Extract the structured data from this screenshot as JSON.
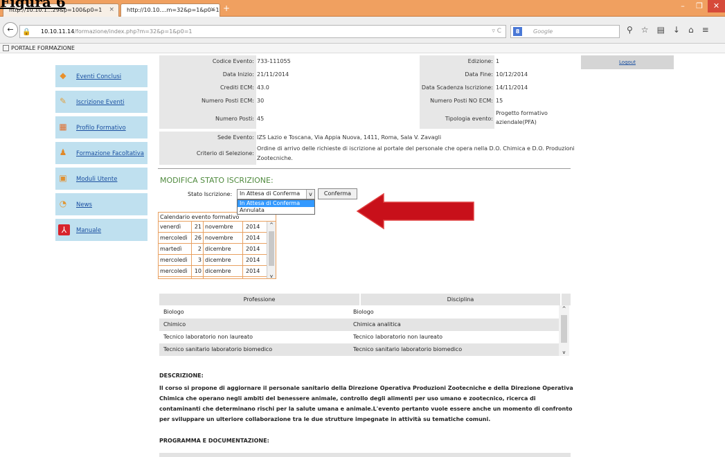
{
  "figure_label": "Figura 6",
  "browser": {
    "tabs": [
      {
        "title": "http://10.10.1...29&p=100&p0=1"
      },
      {
        "title": "http://10.10....m=32&p=1&p0=1"
      }
    ],
    "new_tab": "+",
    "url_host": "10.10.11.14",
    "url_path": "/formazione/index.php?m=32&p=1&p0=1",
    "search_placeholder": "Google",
    "bookmark": "PORTALE FORMAZIONE"
  },
  "sidebar": {
    "items": [
      {
        "label": "Eventi Conclusi",
        "icon": "bell-icon",
        "color": "#e8902c"
      },
      {
        "label": "Iscrizione Eventi",
        "icon": "pencil-icon",
        "color": "#e0a040"
      },
      {
        "label": "Profilo Formativo",
        "icon": "chart-icon",
        "color": "#e07030"
      },
      {
        "label": "Formazione Facoltativa",
        "icon": "people-icon",
        "color": "#e08828"
      },
      {
        "label": "Moduli Utente",
        "icon": "clipboard-icon",
        "color": "#e09030"
      },
      {
        "label": "News",
        "icon": "rss-icon",
        "color": "#e09838"
      },
      {
        "label": "Manuale",
        "icon": "pdf-icon",
        "color": "#d8242c"
      }
    ]
  },
  "logout": "Logout",
  "event": {
    "codice_label": "Codice Evento:",
    "codice": "733-111055",
    "edizione_label": "Edizione:",
    "edizione": "1",
    "data_inizio_label": "Data Inizio:",
    "data_inizio": "21/11/2014",
    "data_fine_label": "Data Fine:",
    "data_fine": "10/12/2014",
    "crediti_label": "Crediti ECM:",
    "crediti": "43.0",
    "scadenza_label": "Data Scadenza Iscrizione:",
    "scadenza": "14/11/2014",
    "posti_ecm_label": "Numero Posti ECM:",
    "posti_ecm": "30",
    "posti_no_ecm_label": "Numero Posti NO ECM:",
    "posti_no_ecm": "15",
    "posti_label": "Numero Posti:",
    "posti": "45",
    "tipologia_label": "Tipologia evento:",
    "tipologia_1": "Progetto formativo",
    "tipologia_2": "aziendale(PFA)",
    "sede_label": "Sede Evento:",
    "sede": "IZS Lazio e Toscana, Via Appia Nuova, 1411, Roma, Sala V. Zavagli",
    "criterio_label": "Criterio di Selezione:",
    "criterio_1": "Ordine di arrivo delle richieste di iscrizione al portale del personale che opera nella D.O. Chimica e D.O. Produzioni",
    "criterio_2": "Zootecniche."
  },
  "modifica": {
    "title": "MODIFICA STATO ISCRIZIONE:",
    "stato_label": "Stato Iscrizione:",
    "selected": "In Attesa di Conferma",
    "options": [
      "In Attesa di Conferma",
      "Annulata"
    ],
    "confirm": "Conferma"
  },
  "calendar": {
    "title": "Calendario evento formativo",
    "rows": [
      {
        "day": "venerdì",
        "num": "21",
        "month": "novembre",
        "year": "2014"
      },
      {
        "day": "mercoledì",
        "num": "26",
        "month": "novembre",
        "year": "2014"
      },
      {
        "day": "martedì",
        "num": "2",
        "month": "dicembre",
        "year": "2014"
      },
      {
        "day": "mercoledì",
        "num": "3",
        "month": "dicembre",
        "year": "2014"
      },
      {
        "day": "mercoledì",
        "num": "10",
        "month": "dicembre",
        "year": "2014"
      }
    ]
  },
  "professioni": {
    "head_professione": "Professione",
    "head_disciplina": "Disciplina",
    "rows": [
      {
        "professione": "Biologo",
        "disciplina": "Biologo"
      },
      {
        "professione": "Chimico",
        "disciplina": "Chimica analitica"
      },
      {
        "professione": "Tecnico laboratorio non laureato",
        "disciplina": "Tecnico laboratorio non laureato"
      },
      {
        "professione": "Tecnico sanitario laboratorio biomedico",
        "disciplina": "Tecnico sanitario laboratorio biomedico"
      }
    ]
  },
  "descrizione": {
    "title": "DESCRIZIONE:",
    "text": "Il corso si propone di aggiornare il personale sanitario della Direzione Operativa Produzioni Zootecniche e della Direzione Operativa Chimica che operano negli ambiti del benessere animale, controllo degli alimenti per uso umano e zootecnico, ricerca di contaminanti che determinano rischi per la salute umana e animale.L'evento pertanto vuole essere anche un momento di confronto per sviluppare un ulteriore collaborazione tra le due strutture impegnate in attività su tematiche comuni."
  },
  "programma": {
    "title": "PROGRAMMA E DOCUMENTAZIONE:"
  }
}
